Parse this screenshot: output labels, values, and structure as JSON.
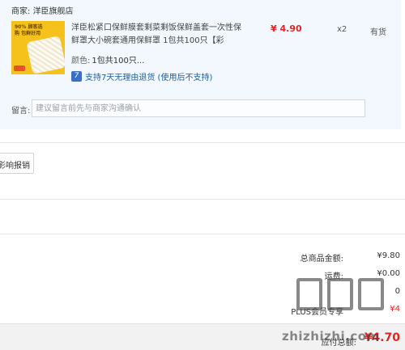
{
  "order": {
    "shop_label": "商家:",
    "shop_name": "洋臣旗舰店",
    "item": {
      "thumb_text": "90% 顾客选购 包鲜好用",
      "title": "洋臣松紧口保鲜膜套剩菜剩饭保鲜盖套一次性保鲜罩大小碗套通用保鲜罩 1包共100只【彩",
      "attr_label": "颜色:",
      "attr_value": "1包共100只...",
      "return_icon": "return-badge-icon",
      "return_note": "支持7天无理由退货 (使用后不支持)",
      "price": "¥ 4.90",
      "quantity": "x2",
      "stock_status": "有货"
    },
    "remark": {
      "label": "留言:",
      "placeholder": "建议留言前先与商家沟通确认",
      "value": ""
    }
  },
  "invoice": {
    "button_label": "影响报销"
  },
  "summary": {
    "rows": [
      {
        "label": "总商品金额:",
        "value": "¥9.80"
      },
      {
        "label": "运费:",
        "value": "¥0.00"
      },
      {
        "label": "",
        "value": "0"
      },
      {
        "label": "PLUS会员专享",
        "value": "¥4"
      }
    ],
    "pay_label": "应付总额:",
    "pay_value": "¥4.70"
  },
  "watermark": {
    "text": "zhizhizhi.com"
  },
  "colors": {
    "accent_red": "#e02424",
    "card_bg": "#f2f8fd",
    "link_blue": "#1b5fa8"
  }
}
